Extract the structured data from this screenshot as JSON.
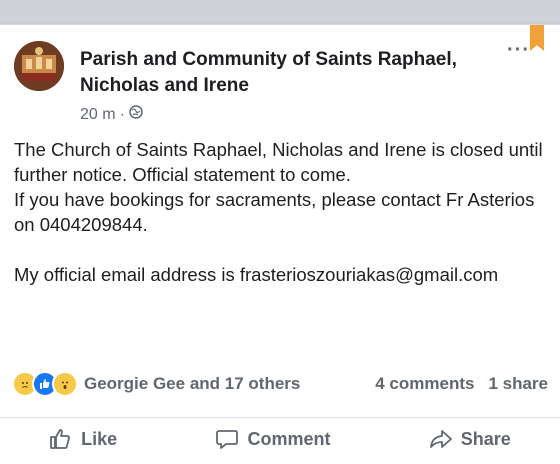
{
  "post": {
    "page_name": "Parish and Community of Saints Raphael, Nicholas and Irene",
    "timestamp": "20 m",
    "separator": "·",
    "privacy_icon": "globe-icon",
    "more_label": "···",
    "lines": [
      "The Church of Saints Raphael, Nicholas and Irene is closed until further notice. Official statement to come.",
      "If you have bookings for sacraments, please contact Fr Asterios on 0404209844.",
      "",
      "My official email address is frasterioszouriakas@gmail.com"
    ]
  },
  "reactions": {
    "icons": [
      "sad-reaction-icon",
      "like-reaction-icon",
      "wow-reaction-icon"
    ],
    "summary": "Georgie Gee and 17 others",
    "comments": "4 comments",
    "shares": "1 share"
  },
  "actions": {
    "like": "Like",
    "comment": "Comment",
    "share": "Share"
  },
  "colors": {
    "background": "#c9ccd1",
    "bookmark": "#f0a13a",
    "like_blue": "#1877f2",
    "muted_text": "#606770"
  }
}
